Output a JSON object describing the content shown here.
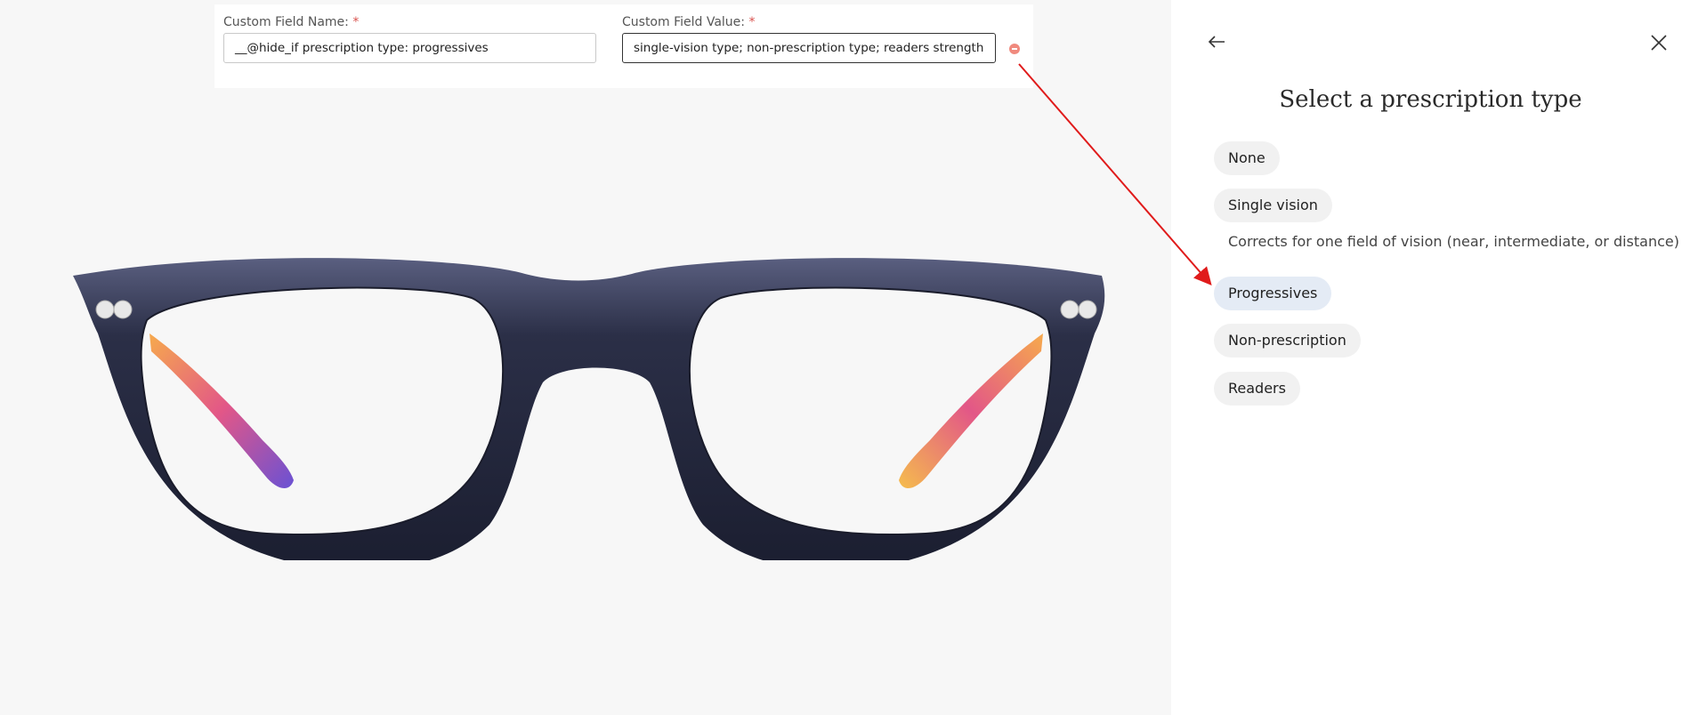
{
  "custom_field": {
    "name_label": "Custom Field Name:",
    "value_label": "Custom Field Value:",
    "required_marker": "*",
    "name_value": "__@hide_if prescription type: progressives",
    "value_value": "single-vision type; non-prescription type; readers strength"
  },
  "sidebar": {
    "title": "Select a prescription type",
    "options": [
      {
        "label": "None"
      },
      {
        "label": "Single vision",
        "description": "Corrects for one field of vision (near, intermediate, or distance)"
      },
      {
        "label": "Progressives",
        "selected": true
      },
      {
        "label": "Non-prescription"
      },
      {
        "label": "Readers"
      }
    ]
  },
  "colors": {
    "annotation_arrow": "#e01b1b",
    "selected_option_bg": "#e4ebf5",
    "option_bg": "#f1f1f1",
    "frame": "#23263a",
    "remove_button": "#f08a7e"
  },
  "icons": {
    "back": "back-arrow-icon",
    "close": "close-icon",
    "remove": "remove-field-icon"
  }
}
